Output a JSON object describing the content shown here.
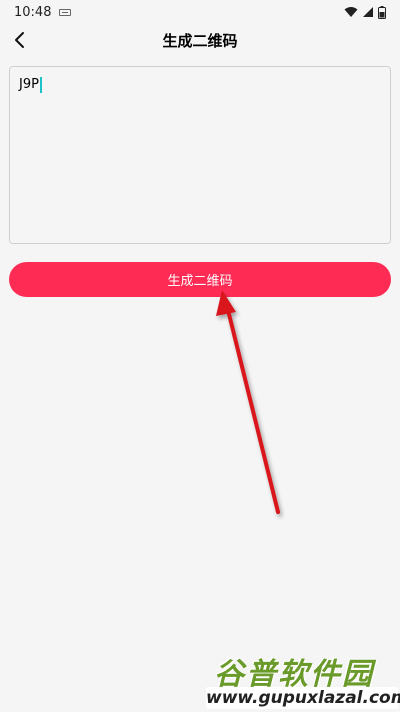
{
  "status_bar": {
    "time": "10:48"
  },
  "app_bar": {
    "title": "生成二维码"
  },
  "input": {
    "value": "J9P"
  },
  "button": {
    "label": "生成二维码"
  },
  "watermark": {
    "brand_text": "谷普软件园",
    "url": "www.gupuxlazal.com"
  },
  "colors": {
    "accent": "#fe2c55",
    "caret": "#19c3c9",
    "arrow": "#d8151d",
    "background": "#f5f5f5"
  },
  "icons": {
    "back": "chevron-left-icon",
    "keyboard": "keyboard-icon",
    "wifi": "wifi-icon",
    "signal": "signal-icon",
    "battery": "battery-icon"
  }
}
